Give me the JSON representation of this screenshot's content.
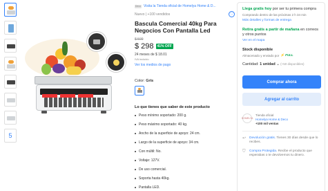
{
  "thumbnails": {
    "more_label": "5"
  },
  "seller_banner": {
    "logo_text": "Deco",
    "text": "Visita la Tienda oficial de Homelya Home & D..."
  },
  "product": {
    "condition_sold": "Nuevo  |  +100 vendidos",
    "title": "Bascula Comercial 40kg Para Negocios Con Pantalla Led",
    "old_price": "$ 509",
    "price": "$ 298",
    "discount": "41% OFF",
    "installments": "24 meses de $ 18.01",
    "iva": "IVA incluido",
    "payment_link": "Ver los medios de pago",
    "color_label": "Color:",
    "color_value": "Gris"
  },
  "features": {
    "title": "Lo que tienes que saber de este producto",
    "items": [
      "Peso mínimo soportado: 200 g.",
      "Peso máximo soportado: 40 kg.",
      "Ancho de la superficie de apoyo: 24 cm.",
      "Largo de la superficie de apoyo: 34 cm.",
      "Con múltil: No.",
      "Voltaje: 127V.",
      "De uso comercial.",
      "Soporta hasta 40kg.",
      "Pantalla LED."
    ]
  },
  "buybox": {
    "ship_free": "Llega gratis hoy",
    "ship_free_rest": " por ser tu primera compra",
    "ship_sub": "Comprando dentro de las próximas 2 h 34 min",
    "ship_link": "Más detalles y formas de entrega",
    "pickup_free": "Retira gratis a partir de mañana",
    "pickup_rest": " en correos y otros puntos",
    "pickup_link": "Ver en el mapa",
    "stock_title": "Stock disponible",
    "stock_sub": "Almacenado y enviado por",
    "full_label": "⚡ FULL",
    "qty_label": "Cantidad: ",
    "qty_value": "1 unidad",
    "qty_avail": " (+50 disponibles)",
    "buy_now": "Comprar ahora",
    "add_cart": "Agregar al carrito",
    "store_logo": "HOMELYA",
    "store_type": "Tienda oficial",
    "store_name": "Homelya Home & Deco",
    "store_sales": "+100 mil ventas",
    "return_link": "Devolución gratis.",
    "return_text": " Tienes 30 días desde que lo recibes.",
    "protect_link": "Compra Protegida.",
    "protect_text": " Recibe el producto que esperabas o te devolvemos tu dinero."
  }
}
